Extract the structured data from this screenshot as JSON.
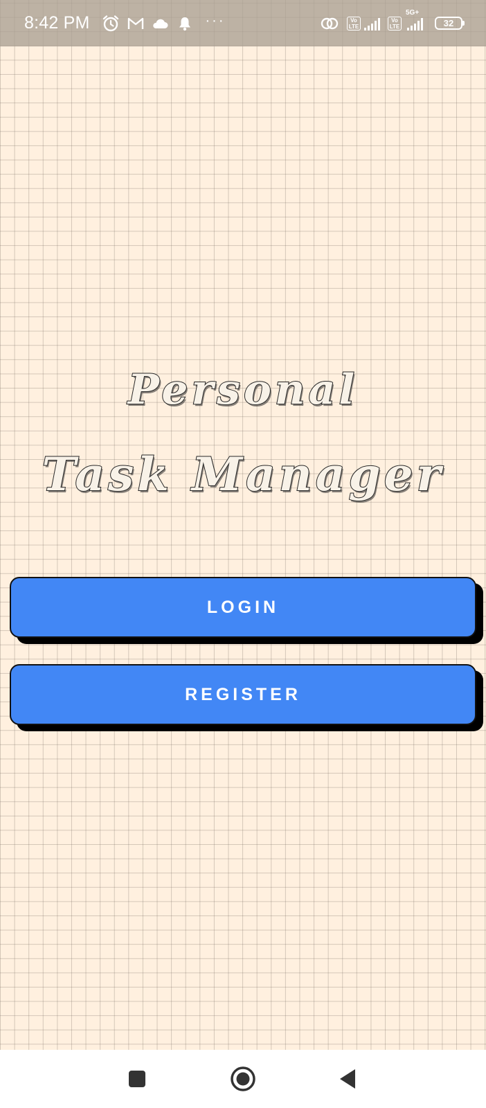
{
  "status_bar": {
    "time": "8:42 PM",
    "icons_left": [
      "alarm-icon",
      "gmail-icon",
      "cloud-icon",
      "notification-bell-icon",
      "more-dots-icon"
    ],
    "more": "···",
    "volte_label": "Vo LTE",
    "network_5g": "5G+",
    "battery": "32"
  },
  "app": {
    "title_line1": "Personal",
    "title_line2": "Task Manager"
  },
  "buttons": {
    "login": "LOGIN",
    "register": "REGISTER"
  },
  "colors": {
    "background": "#fff0df",
    "grid": "#8c8278",
    "button": "#4287f5",
    "button_shadow": "#000000"
  },
  "nav": {
    "items": [
      "recents-icon",
      "home-icon",
      "back-icon"
    ]
  }
}
